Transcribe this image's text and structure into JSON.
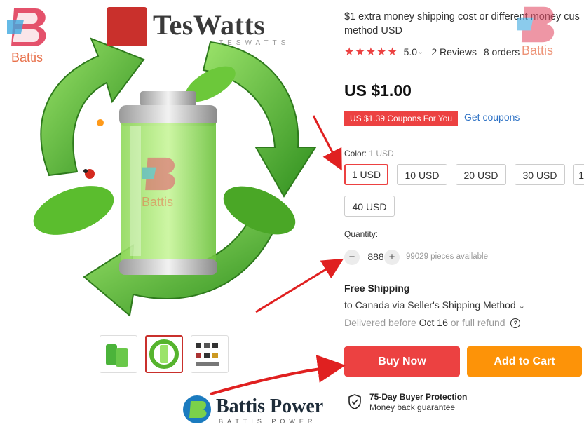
{
  "product": {
    "title": "$1 extra money shipping cost or different money cus method USD",
    "title_line1": "$1 extra money shipping cost or different money cus",
    "title_line2": "method USD",
    "stars": "★★★★★",
    "rating": "5.0",
    "reviews": "2 Reviews",
    "orders": "8 orders",
    "price": "US $1.00",
    "coupon_badge": "US $1.39 Coupons For You",
    "get_coupons": "Get coupons"
  },
  "color": {
    "label": "Color:",
    "selected_value": "1 USD",
    "options": [
      "1 USD",
      "10 USD",
      "20 USD",
      "30 USD",
      "1",
      "40 USD"
    ]
  },
  "quantity": {
    "label": "Quantity:",
    "minus": "−",
    "value": "888",
    "plus": "+",
    "available": "99029 pieces available"
  },
  "shipping": {
    "title": "Free Shipping",
    "line": "to Canada via Seller's Shipping Method",
    "chevron": "⌄",
    "delivered_prefix": "Delivered before",
    "date": "Oct 16",
    "delivered_suffix": "or full refund",
    "help": "?"
  },
  "actions": {
    "buy_now": "Buy Now",
    "add_to_cart": "Add to Cart"
  },
  "protection": {
    "title": "75-Day Buyer Protection",
    "subtitle": "Money back guarantee"
  },
  "branding": {
    "battis_tag": "Battis",
    "battis_tag_right": "Battis",
    "battis_tag_center": "Battis",
    "teswatts_name": "TesWatts",
    "teswatts_sub": "TESWATTS",
    "battis_power_name": "Battis Power",
    "battis_power_sub": "BATTIS POWER"
  },
  "colors": {
    "accent_red": "#ec4141",
    "accent_orange": "#fd9308",
    "link_blue": "#2e72c5",
    "arrow_red": "#e02020"
  }
}
